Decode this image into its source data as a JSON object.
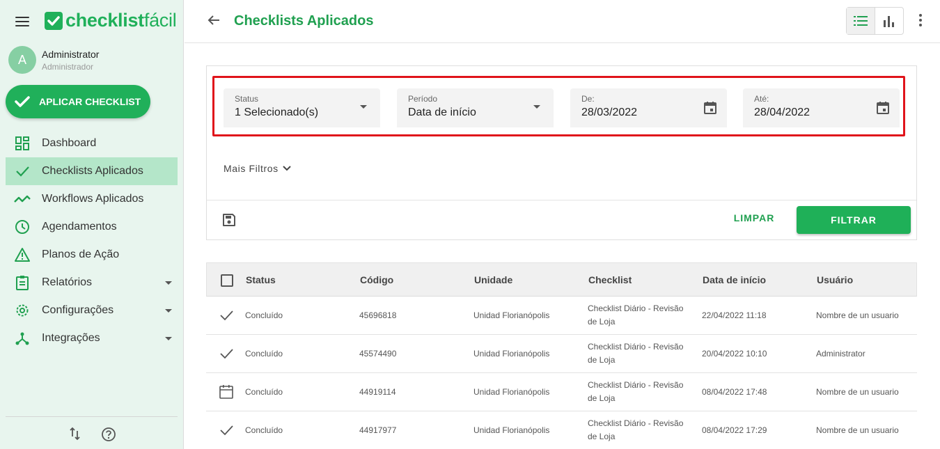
{
  "app": {
    "logo_bold": "checklist",
    "logo_light": "fácil",
    "brand_color": "#20b05a",
    "highlight_color": "#e0141b"
  },
  "user": {
    "initial": "A",
    "name": "Administrator",
    "role": "Administrador"
  },
  "sidebar": {
    "apply_button": "APLICAR CHECKLIST",
    "items": [
      {
        "label": "Dashboard",
        "icon": "dashboard-icon",
        "active": false,
        "has_submenu": false
      },
      {
        "label": "Checklists Aplicados",
        "icon": "check-icon",
        "active": true,
        "has_submenu": false
      },
      {
        "label": "Workflows Aplicados",
        "icon": "trending-icon",
        "active": false,
        "has_submenu": false
      },
      {
        "label": "Agendamentos",
        "icon": "clock-icon",
        "active": false,
        "has_submenu": false
      },
      {
        "label": "Planos de Ação",
        "icon": "warning-icon",
        "active": false,
        "has_submenu": false
      },
      {
        "label": "Relatórios",
        "icon": "clipboard-icon",
        "active": false,
        "has_submenu": true
      },
      {
        "label": "Configurações",
        "icon": "gear-icon",
        "active": false,
        "has_submenu": true
      },
      {
        "label": "Integrações",
        "icon": "hub-icon",
        "active": false,
        "has_submenu": true
      }
    ]
  },
  "header": {
    "title": "Checklists Aplicados"
  },
  "filters": {
    "status": {
      "label": "Status",
      "value": "1 Selecionado(s)"
    },
    "period": {
      "label": "Período",
      "value": "Data de início"
    },
    "from": {
      "label": "De:",
      "value": "28/03/2022"
    },
    "to": {
      "label": "Até:",
      "value": "28/04/2022"
    },
    "more_filters": "Mais Filtros",
    "clear_label": "LIMPAR",
    "filter_label": "FILTRAR"
  },
  "table": {
    "columns": [
      "Status",
      "Código",
      "Unidade",
      "Checklist",
      "Data de início",
      "Usuário"
    ],
    "rows": [
      {
        "icon": "check-icon",
        "status": "Concluído",
        "code": "45696818",
        "unit": "Unidad Florianópolis",
        "checklist_1": "Checklist Diário - Revisão",
        "checklist_2": "de Loja",
        "date": "22/04/2022 11:18",
        "user": "Nombre de un usuario"
      },
      {
        "icon": "check-icon",
        "status": "Concluído",
        "code": "45574490",
        "unit": "Unidad Florianópolis",
        "checklist_1": "Checklist Diário - Revisão",
        "checklist_2": "de Loja",
        "date": "20/04/2022 10:10",
        "user": "Administrator"
      },
      {
        "icon": "calendar-icon",
        "status": "Concluído",
        "code": "44919114",
        "unit": "Unidad Florianópolis",
        "checklist_1": "Checklist Diário - Revisão",
        "checklist_2": "de Loja",
        "date": "08/04/2022 17:48",
        "user": "Nombre de un usuario"
      },
      {
        "icon": "check-icon",
        "status": "Concluído",
        "code": "44917977",
        "unit": "Unidad Florianópolis",
        "checklist_1": "Checklist Diário - Revisão",
        "checklist_2": "de Loja",
        "date": "08/04/2022 17:29",
        "user": "Nombre de un usuario"
      }
    ]
  }
}
